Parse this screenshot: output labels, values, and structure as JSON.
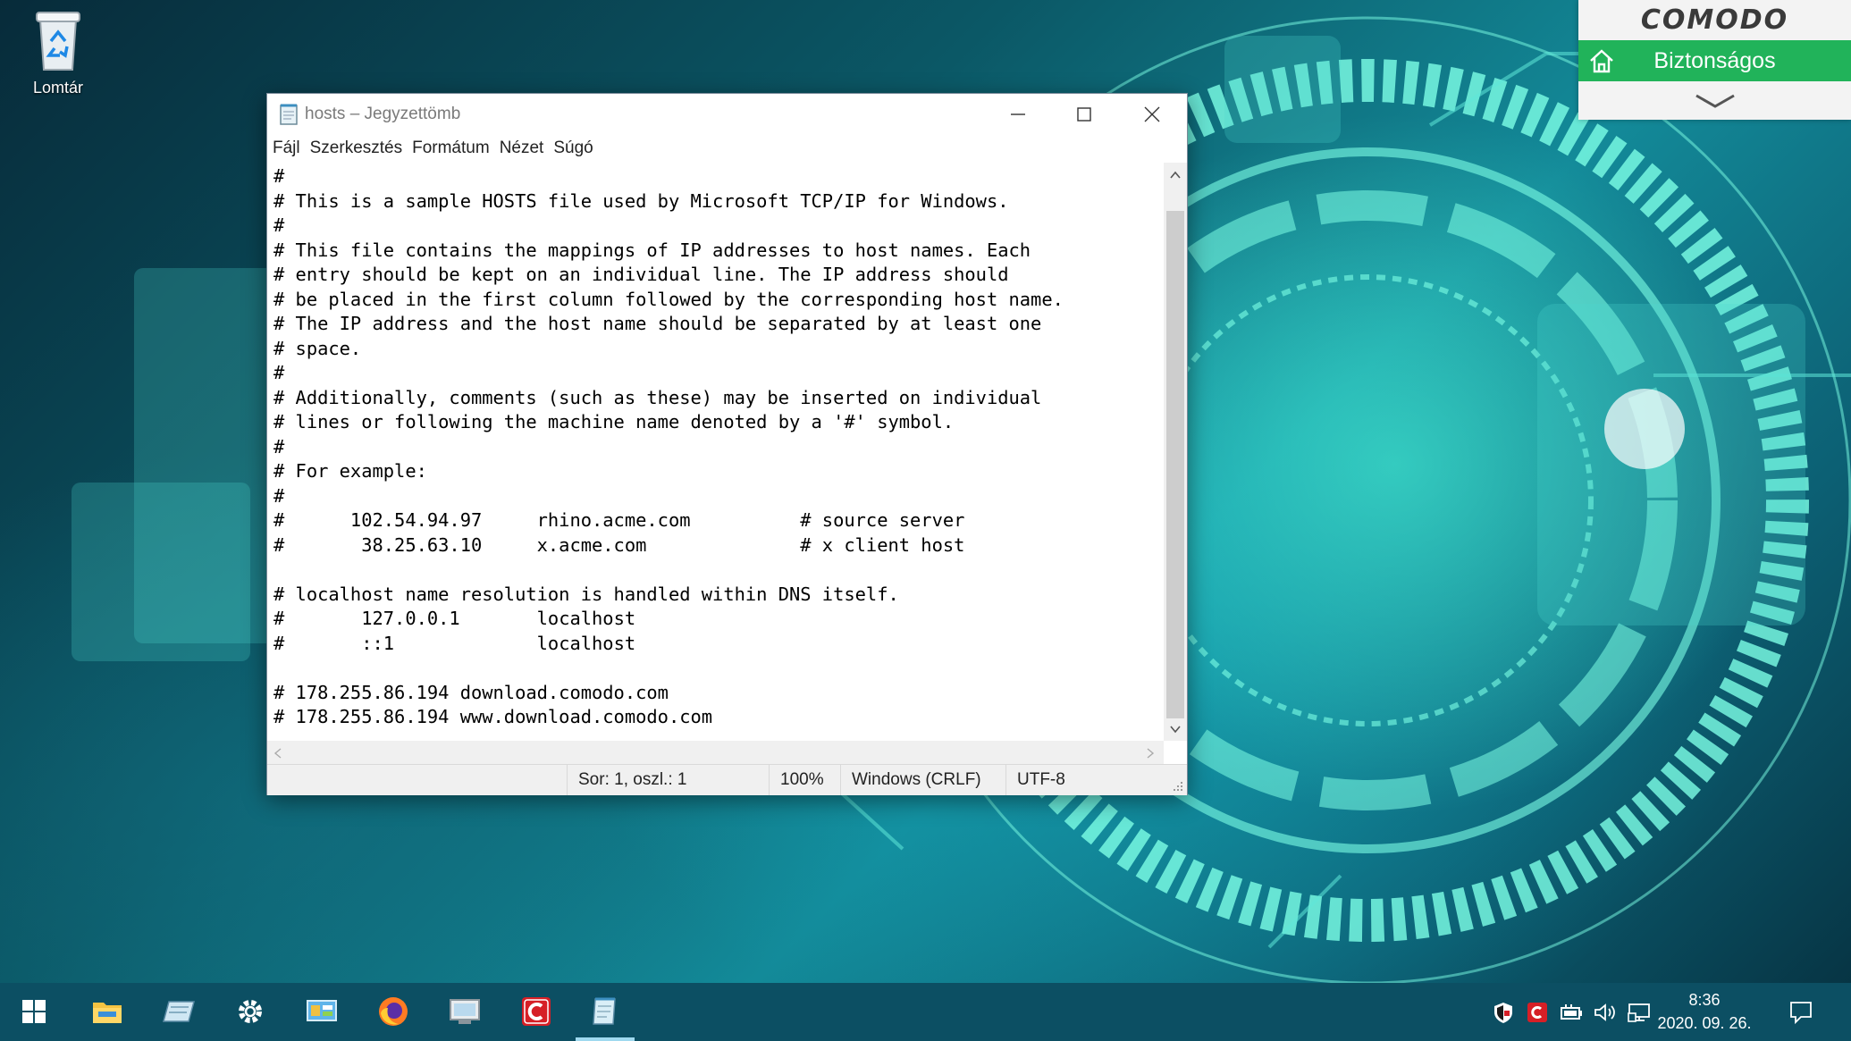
{
  "desktop": {
    "recycle_bin_label": "Lomtár"
  },
  "comodo_widget": {
    "brand": "COMODO",
    "status": "Biztonságos",
    "colors": {
      "status_bg": "#21b35a"
    }
  },
  "notepad": {
    "title": "hosts – Jegyzettömb",
    "menu": [
      "Fájl",
      "Szerkesztés",
      "Formátum",
      "Nézet",
      "Súgó"
    ],
    "content": "#\n# This is a sample HOSTS file used by Microsoft TCP/IP for Windows.\n#\n# This file contains the mappings of IP addresses to host names. Each\n# entry should be kept on an individual line. The IP address should\n# be placed in the first column followed by the corresponding host name.\n# The IP address and the host name should be separated by at least one\n# space.\n#\n# Additionally, comments (such as these) may be inserted on individual\n# lines or following the machine name denoted by a '#' symbol.\n#\n# For example:\n#\n#      102.54.94.97     rhino.acme.com          # source server\n#       38.25.63.10     x.acme.com              # x client host\n\n# localhost name resolution is handled within DNS itself.\n#\t127.0.0.1       localhost\n#\t::1             localhost\n\n# 178.255.86.194 download.comodo.com\n# 178.255.86.194 www.download.comodo.com",
    "status": {
      "position": "Sor: 1, oszl.: 1",
      "zoom": "100%",
      "line_ending": "Windows (CRLF)",
      "encoding": "UTF-8"
    }
  },
  "taskbar": {
    "apps": [
      "start-icon",
      "file-explorer-icon",
      "notepad-app-icon",
      "settings-icon",
      "control-panel-icon",
      "firefox-icon",
      "network-app-icon",
      "comodo-icon",
      "notepad-active-icon"
    ],
    "tray": [
      "security-shield-icon",
      "comodo-tray-icon",
      "battery-icon",
      "volume-icon",
      "network-icon"
    ],
    "time": "8:36",
    "date": "2020. 09. 26."
  }
}
